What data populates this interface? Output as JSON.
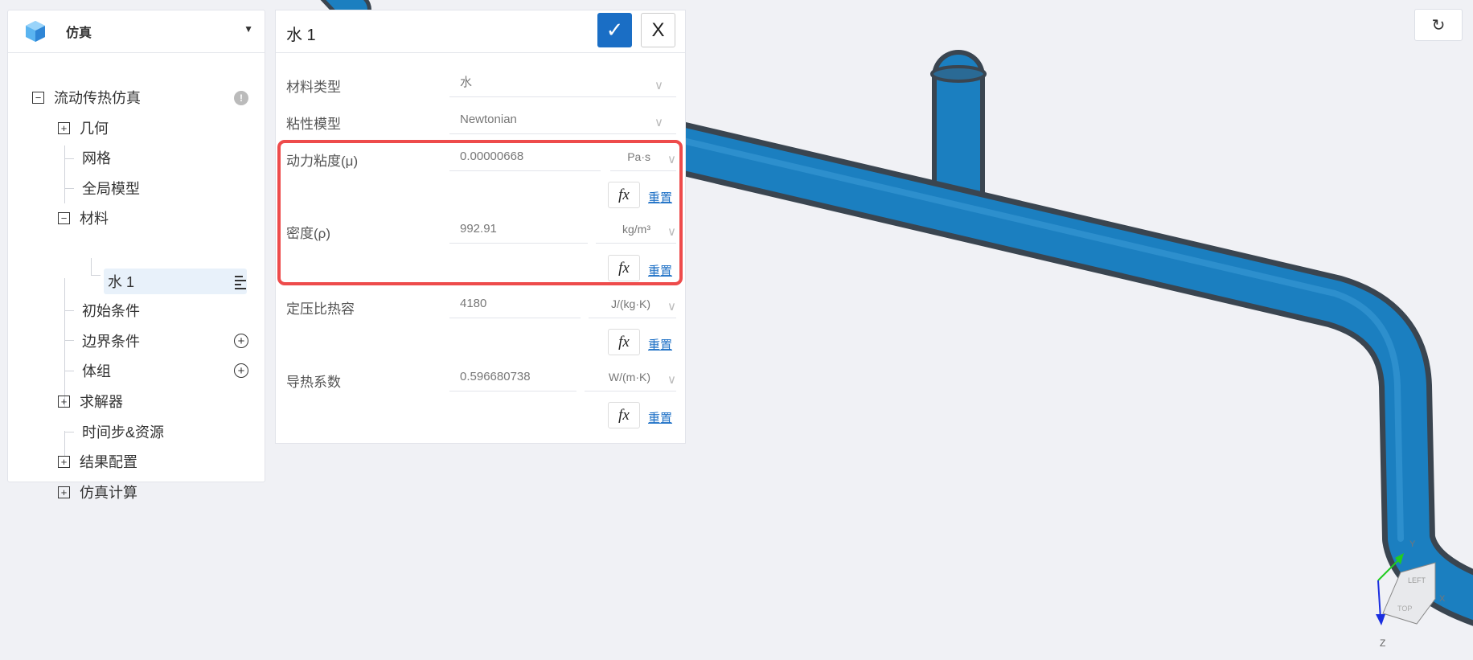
{
  "sidebar": {
    "title": "仿真",
    "tree": [
      {
        "label": "流动传热仿真",
        "toggle": "−"
      },
      {
        "label": "几何",
        "toggle": "+"
      },
      {
        "label": "网格"
      },
      {
        "label": "全局模型"
      },
      {
        "label": "材料",
        "toggle": "−"
      },
      {
        "label": "水 1"
      },
      {
        "label": "初始条件"
      },
      {
        "label": "边界条件"
      },
      {
        "label": "体组"
      },
      {
        "label": "求解器",
        "toggle": "+"
      },
      {
        "label": "时间步&资源"
      },
      {
        "label": "结果配置",
        "toggle": "+"
      },
      {
        "label": "仿真计算",
        "toggle": "+"
      }
    ],
    "warning_icon": "!",
    "add_icon": "+"
  },
  "panel": {
    "title": "水 1",
    "confirm_icon": "✓",
    "close_icon": "X",
    "fields": [
      {
        "label": "材料类型",
        "value": "水"
      },
      {
        "label": "粘性模型",
        "value": "Newtonian"
      },
      {
        "label": "动力粘度(μ)",
        "value": "0.00000668",
        "unit": "Pa·s",
        "fx": "fx",
        "reset": "重置"
      },
      {
        "label": "密度(ρ)",
        "value": "992.91",
        "unit": "kg/m³",
        "fx": "fx",
        "reset": "重置"
      },
      {
        "label": "定压比热容",
        "value": "4180",
        "unit": "J/(kg·K)",
        "fx": "fx",
        "reset": "重置"
      },
      {
        "label": "导热系数",
        "value": "0.596680738",
        "unit": "W/(m·K)",
        "fx": "fx",
        "reset": "重置"
      }
    ]
  },
  "viewer": {
    "refresh_icon": "↻",
    "axes": {
      "x": "X",
      "y": "Y",
      "z": "Z"
    },
    "cube_faces": [
      "LEFT",
      "TOP"
    ],
    "colors": {
      "pipe": "#1b7fc0",
      "highlight": "#ee4b4b",
      "accent": "#1a6ec5"
    }
  }
}
